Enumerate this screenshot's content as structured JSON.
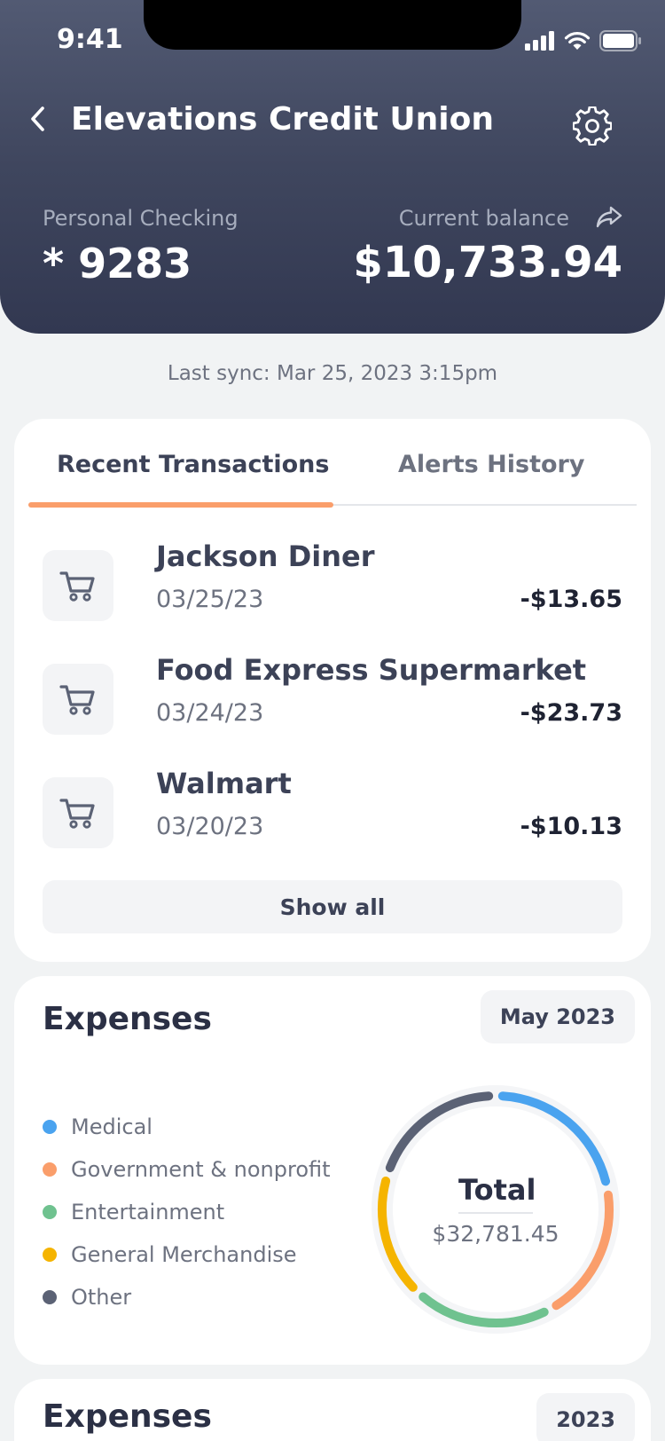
{
  "status_bar": {
    "time": "9:41",
    "icons": [
      "signal-icon",
      "wifi-icon",
      "battery-icon"
    ]
  },
  "nav": {
    "title": "Elevations Credit Union",
    "back_icon": "chevron-left-icon",
    "settings_icon": "gear-icon"
  },
  "account": {
    "type_label": "Personal Checking",
    "number": "* 9283",
    "balance_label": "Current balance",
    "balance": "$10,733.94",
    "share_icon": "share-icon"
  },
  "sync_text": "Last sync: Mar 25, 2023 3:15pm",
  "tabs": [
    {
      "label": "Recent Transactions",
      "active": true
    },
    {
      "label": "Alerts History",
      "active": false
    }
  ],
  "transactions": [
    {
      "name": "Jackson Diner",
      "date": "03/25/23",
      "amount": "-$13.65",
      "icon": "cart-icon"
    },
    {
      "name": "Food Express Supermarket",
      "date": "03/24/23",
      "amount": "-$23.73",
      "icon": "cart-icon"
    },
    {
      "name": "Walmart",
      "date": "03/20/23",
      "amount": "-$10.13",
      "icon": "cart-icon"
    }
  ],
  "show_all_label": "Show all",
  "expenses": {
    "title": "Expenses",
    "period": "May 2023",
    "total_label": "Total",
    "total_value": "$32,781.45",
    "categories": [
      {
        "name": "Medical",
        "color": "#4aa3ef",
        "share": 0.22
      },
      {
        "name": "Government & nonprofit",
        "color": "#fa9e6b",
        "share": 0.2
      },
      {
        "name": "Entertainment",
        "color": "#6fc28f",
        "share": 0.2
      },
      {
        "name": "General Merchandise",
        "color": "#f5b400",
        "share": 0.18
      },
      {
        "name": "Other",
        "color": "#5b6275",
        "share": 0.2
      }
    ]
  },
  "expenses_yearly": {
    "title": "Expenses",
    "period": "2023"
  }
}
